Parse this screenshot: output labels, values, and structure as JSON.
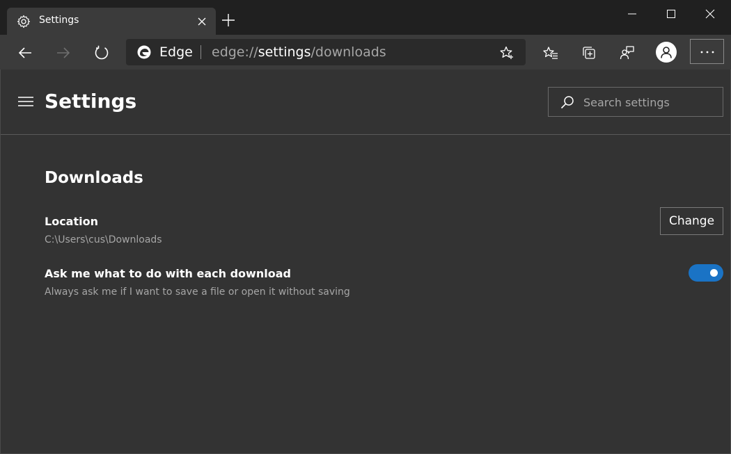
{
  "tab": {
    "title": "Settings"
  },
  "address_bar": {
    "brand": "Edge",
    "url_scheme": "edge://",
    "url_host": "settings",
    "url_path": "/downloads"
  },
  "header": {
    "title": "Settings",
    "search_placeholder": "Search settings"
  },
  "downloads": {
    "section_title": "Downloads",
    "location_label": "Location",
    "location_value": "C:\\Users\\cus\\Downloads",
    "change_button": "Change",
    "ask_label": "Ask me what to do with each download",
    "ask_description": "Always ask me if I want to save a file or open it without saving",
    "ask_enabled": true
  },
  "colors": {
    "accent": "#1a73c5",
    "page_background": "#333333",
    "toolbar_background": "#3b3b3b",
    "tabstrip_background": "#202020"
  },
  "icons": [
    "gear-icon",
    "close-icon",
    "plus-icon",
    "minimize-icon",
    "maximize-icon",
    "back-icon",
    "forward-icon",
    "refresh-icon",
    "edge-logo-icon",
    "add-favorite-icon",
    "favorites-icon",
    "collections-icon",
    "feedback-icon",
    "profile-icon",
    "more-icon",
    "hamburger-icon",
    "search-icon"
  ]
}
